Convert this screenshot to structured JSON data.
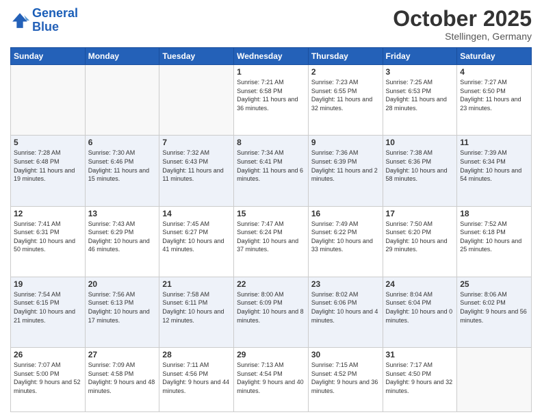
{
  "header": {
    "logo_general": "General",
    "logo_blue": "Blue",
    "month": "October 2025",
    "location": "Stellingen, Germany"
  },
  "days_of_week": [
    "Sunday",
    "Monday",
    "Tuesday",
    "Wednesday",
    "Thursday",
    "Friday",
    "Saturday"
  ],
  "weeks": [
    [
      {
        "day": "",
        "sunrise": "",
        "sunset": "",
        "daylight": ""
      },
      {
        "day": "",
        "sunrise": "",
        "sunset": "",
        "daylight": ""
      },
      {
        "day": "",
        "sunrise": "",
        "sunset": "",
        "daylight": ""
      },
      {
        "day": "1",
        "sunrise": "Sunrise: 7:21 AM",
        "sunset": "Sunset: 6:58 PM",
        "daylight": "Daylight: 11 hours and 36 minutes."
      },
      {
        "day": "2",
        "sunrise": "Sunrise: 7:23 AM",
        "sunset": "Sunset: 6:55 PM",
        "daylight": "Daylight: 11 hours and 32 minutes."
      },
      {
        "day": "3",
        "sunrise": "Sunrise: 7:25 AM",
        "sunset": "Sunset: 6:53 PM",
        "daylight": "Daylight: 11 hours and 28 minutes."
      },
      {
        "day": "4",
        "sunrise": "Sunrise: 7:27 AM",
        "sunset": "Sunset: 6:50 PM",
        "daylight": "Daylight: 11 hours and 23 minutes."
      }
    ],
    [
      {
        "day": "5",
        "sunrise": "Sunrise: 7:28 AM",
        "sunset": "Sunset: 6:48 PM",
        "daylight": "Daylight: 11 hours and 19 minutes."
      },
      {
        "day": "6",
        "sunrise": "Sunrise: 7:30 AM",
        "sunset": "Sunset: 6:46 PM",
        "daylight": "Daylight: 11 hours and 15 minutes."
      },
      {
        "day": "7",
        "sunrise": "Sunrise: 7:32 AM",
        "sunset": "Sunset: 6:43 PM",
        "daylight": "Daylight: 11 hours and 11 minutes."
      },
      {
        "day": "8",
        "sunrise": "Sunrise: 7:34 AM",
        "sunset": "Sunset: 6:41 PM",
        "daylight": "Daylight: 11 hours and 6 minutes."
      },
      {
        "day": "9",
        "sunrise": "Sunrise: 7:36 AM",
        "sunset": "Sunset: 6:39 PM",
        "daylight": "Daylight: 11 hours and 2 minutes."
      },
      {
        "day": "10",
        "sunrise": "Sunrise: 7:38 AM",
        "sunset": "Sunset: 6:36 PM",
        "daylight": "Daylight: 10 hours and 58 minutes."
      },
      {
        "day": "11",
        "sunrise": "Sunrise: 7:39 AM",
        "sunset": "Sunset: 6:34 PM",
        "daylight": "Daylight: 10 hours and 54 minutes."
      }
    ],
    [
      {
        "day": "12",
        "sunrise": "Sunrise: 7:41 AM",
        "sunset": "Sunset: 6:31 PM",
        "daylight": "Daylight: 10 hours and 50 minutes."
      },
      {
        "day": "13",
        "sunrise": "Sunrise: 7:43 AM",
        "sunset": "Sunset: 6:29 PM",
        "daylight": "Daylight: 10 hours and 46 minutes."
      },
      {
        "day": "14",
        "sunrise": "Sunrise: 7:45 AM",
        "sunset": "Sunset: 6:27 PM",
        "daylight": "Daylight: 10 hours and 41 minutes."
      },
      {
        "day": "15",
        "sunrise": "Sunrise: 7:47 AM",
        "sunset": "Sunset: 6:24 PM",
        "daylight": "Daylight: 10 hours and 37 minutes."
      },
      {
        "day": "16",
        "sunrise": "Sunrise: 7:49 AM",
        "sunset": "Sunset: 6:22 PM",
        "daylight": "Daylight: 10 hours and 33 minutes."
      },
      {
        "day": "17",
        "sunrise": "Sunrise: 7:50 AM",
        "sunset": "Sunset: 6:20 PM",
        "daylight": "Daylight: 10 hours and 29 minutes."
      },
      {
        "day": "18",
        "sunrise": "Sunrise: 7:52 AM",
        "sunset": "Sunset: 6:18 PM",
        "daylight": "Daylight: 10 hours and 25 minutes."
      }
    ],
    [
      {
        "day": "19",
        "sunrise": "Sunrise: 7:54 AM",
        "sunset": "Sunset: 6:15 PM",
        "daylight": "Daylight: 10 hours and 21 minutes."
      },
      {
        "day": "20",
        "sunrise": "Sunrise: 7:56 AM",
        "sunset": "Sunset: 6:13 PM",
        "daylight": "Daylight: 10 hours and 17 minutes."
      },
      {
        "day": "21",
        "sunrise": "Sunrise: 7:58 AM",
        "sunset": "Sunset: 6:11 PM",
        "daylight": "Daylight: 10 hours and 12 minutes."
      },
      {
        "day": "22",
        "sunrise": "Sunrise: 8:00 AM",
        "sunset": "Sunset: 6:09 PM",
        "daylight": "Daylight: 10 hours and 8 minutes."
      },
      {
        "day": "23",
        "sunrise": "Sunrise: 8:02 AM",
        "sunset": "Sunset: 6:06 PM",
        "daylight": "Daylight: 10 hours and 4 minutes."
      },
      {
        "day": "24",
        "sunrise": "Sunrise: 8:04 AM",
        "sunset": "Sunset: 6:04 PM",
        "daylight": "Daylight: 10 hours and 0 minutes."
      },
      {
        "day": "25",
        "sunrise": "Sunrise: 8:06 AM",
        "sunset": "Sunset: 6:02 PM",
        "daylight": "Daylight: 9 hours and 56 minutes."
      }
    ],
    [
      {
        "day": "26",
        "sunrise": "Sunrise: 7:07 AM",
        "sunset": "Sunset: 5:00 PM",
        "daylight": "Daylight: 9 hours and 52 minutes."
      },
      {
        "day": "27",
        "sunrise": "Sunrise: 7:09 AM",
        "sunset": "Sunset: 4:58 PM",
        "daylight": "Daylight: 9 hours and 48 minutes."
      },
      {
        "day": "28",
        "sunrise": "Sunrise: 7:11 AM",
        "sunset": "Sunset: 4:56 PM",
        "daylight": "Daylight: 9 hours and 44 minutes."
      },
      {
        "day": "29",
        "sunrise": "Sunrise: 7:13 AM",
        "sunset": "Sunset: 4:54 PM",
        "daylight": "Daylight: 9 hours and 40 minutes."
      },
      {
        "day": "30",
        "sunrise": "Sunrise: 7:15 AM",
        "sunset": "Sunset: 4:52 PM",
        "daylight": "Daylight: 9 hours and 36 minutes."
      },
      {
        "day": "31",
        "sunrise": "Sunrise: 7:17 AM",
        "sunset": "Sunset: 4:50 PM",
        "daylight": "Daylight: 9 hours and 32 minutes."
      },
      {
        "day": "",
        "sunrise": "",
        "sunset": "",
        "daylight": ""
      }
    ]
  ]
}
